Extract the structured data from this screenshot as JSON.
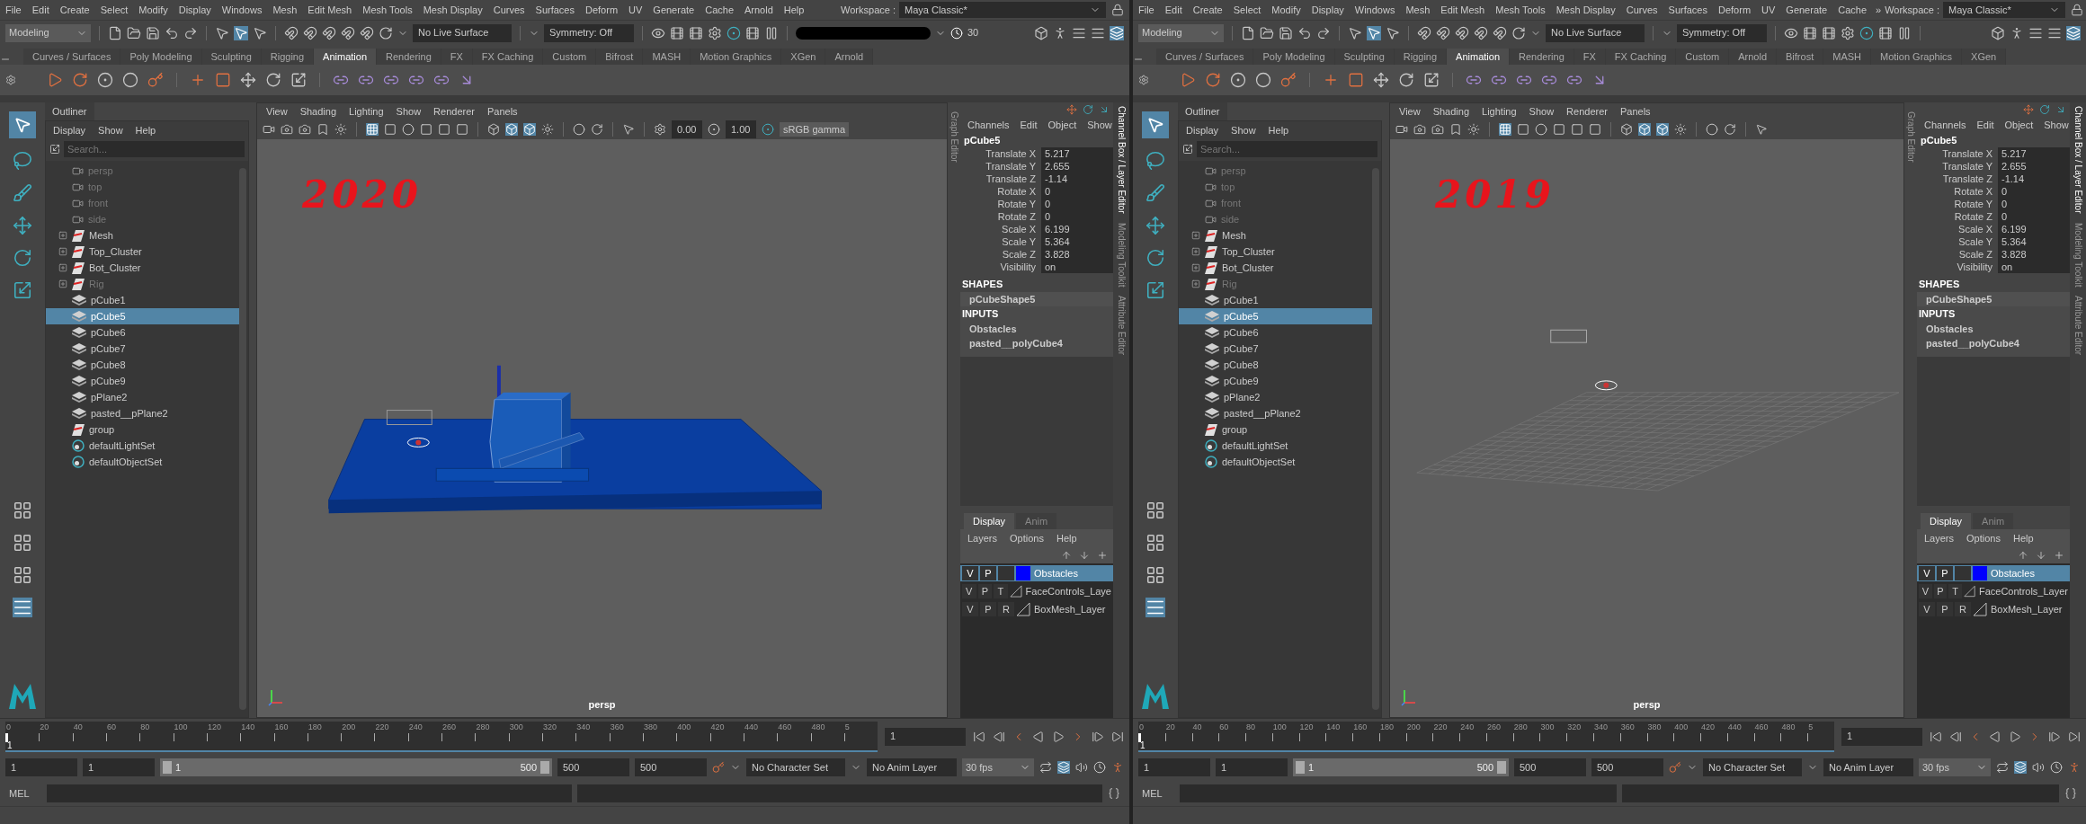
{
  "windows": [
    {
      "menus": [
        "File",
        "Edit",
        "Create",
        "Select",
        "Modify",
        "Display",
        "Windows",
        "Mesh",
        "Edit Mesh",
        "Mesh Tools",
        "Mesh Display",
        "Curves",
        "Surfaces",
        "Deform",
        "UV",
        "Generate",
        "Cache",
        "Arnold",
        "Help"
      ],
      "workspace_label": "Workspace :",
      "workspace": "Maya Classic*",
      "mode": "Modeling",
      "live_surface": "No Live Surface",
      "symmetry": "Symmetry: Off",
      "redacted": true,
      "timer": "30",
      "shelf_tabs": [
        {
          "label": "Curves / Surfaces",
          "selected": false
        },
        {
          "label": "Poly Modeling",
          "selected": false
        },
        {
          "label": "Sculpting",
          "selected": false
        },
        {
          "label": "Rigging",
          "selected": false
        },
        {
          "label": "Animation",
          "selected": true
        },
        {
          "label": "Rendering",
          "selected": false
        },
        {
          "label": "FX",
          "selected": false
        },
        {
          "label": "FX Caching",
          "selected": false
        },
        {
          "label": "Custom",
          "selected": false
        },
        {
          "label": "Bifrost",
          "selected": false
        },
        {
          "label": "MASH",
          "selected": false
        },
        {
          "label": "Motion Graphics",
          "selected": false
        },
        {
          "label": "XGen",
          "selected": false
        },
        {
          "label": "Arnold",
          "selected": false
        }
      ],
      "outliner": {
        "title": "Outliner",
        "menus": [
          "Display",
          "Show",
          "Help"
        ],
        "search_placeholder": "Search...",
        "items": [
          {
            "label": "persp",
            "kind": "camera",
            "dimmed": true,
            "expandable": false,
            "selected": false
          },
          {
            "label": "top",
            "kind": "camera",
            "dimmed": true,
            "expandable": false,
            "selected": false
          },
          {
            "label": "front",
            "kind": "camera",
            "dimmed": true,
            "expandable": false,
            "selected": false
          },
          {
            "label": "side",
            "kind": "camera",
            "dimmed": true,
            "expandable": false,
            "selected": false
          },
          {
            "label": "Mesh",
            "kind": "group",
            "dimmed": false,
            "expandable": true,
            "selected": false
          },
          {
            "label": "Top_Cluster",
            "kind": "group",
            "dimmed": false,
            "expandable": true,
            "selected": false
          },
          {
            "label": "Bot_Cluster",
            "kind": "group",
            "dimmed": false,
            "expandable": true,
            "selected": false
          },
          {
            "label": "Rig",
            "kind": "group",
            "dimmed": true,
            "expandable": true,
            "selected": false
          },
          {
            "label": "pCube1",
            "kind": "mesh",
            "dimmed": false,
            "expandable": false,
            "selected": false
          },
          {
            "label": "pCube5",
            "kind": "mesh",
            "dimmed": false,
            "expandable": false,
            "selected": true
          },
          {
            "label": "pCube6",
            "kind": "mesh",
            "dimmed": false,
            "expandable": false,
            "selected": false
          },
          {
            "label": "pCube7",
            "kind": "mesh",
            "dimmed": false,
            "expandable": false,
            "selected": false
          },
          {
            "label": "pCube8",
            "kind": "mesh",
            "dimmed": false,
            "expandable": false,
            "selected": false
          },
          {
            "label": "pCube9",
            "kind": "mesh",
            "dimmed": false,
            "expandable": false,
            "selected": false
          },
          {
            "label": "pPlane2",
            "kind": "mesh",
            "dimmed": false,
            "expandable": false,
            "selected": false
          },
          {
            "label": "pasted__pPlane2",
            "kind": "mesh",
            "dimmed": false,
            "expandable": false,
            "selected": false
          },
          {
            "label": "group",
            "kind": "group",
            "dimmed": false,
            "expandable": false,
            "selected": false
          },
          {
            "label": "defaultLightSet",
            "kind": "set",
            "dimmed": false,
            "expandable": false,
            "selected": false
          },
          {
            "label": "defaultObjectSet",
            "kind": "set",
            "dimmed": false,
            "expandable": false,
            "selected": false
          }
        ]
      },
      "viewport": {
        "menus": [
          "View",
          "Shading",
          "Lighting",
          "Show",
          "Renderer",
          "Panels"
        ],
        "exposure": "0.00",
        "gamma": "1.00",
        "color_space": "sRGB gamma",
        "annotation": "2020",
        "scene": {
          "kind": "blue-obstacles"
        },
        "camera": "persp"
      },
      "graph_editor_tab": "Graph Editor",
      "channel_box": {
        "menus": [
          "Channels",
          "Edit",
          "Object",
          "Show"
        ],
        "object": "pCube5",
        "attributes": [
          {
            "label": "Translate X",
            "value": "5.217"
          },
          {
            "label": "Translate Y",
            "value": "2.655"
          },
          {
            "label": "Translate Z",
            "value": "-1.14"
          },
          {
            "label": "Rotate X",
            "value": "0"
          },
          {
            "label": "Rotate Y",
            "value": "0"
          },
          {
            "label": "Rotate Z",
            "value": "0"
          },
          {
            "label": "Scale X",
            "value": "6.199"
          },
          {
            "label": "Scale Y",
            "value": "5.364"
          },
          {
            "label": "Scale Z",
            "value": "3.828"
          },
          {
            "label": "Visibility",
            "value": "on"
          }
        ],
        "shapes_header": "SHAPES",
        "shapes": [
          "pCubeShape5"
        ],
        "inputs_header": "INPUTS",
        "inputs": [
          "Obstacles",
          "pasted__polyCube4"
        ]
      },
      "layer_editor": {
        "tabs": [
          {
            "label": "Display",
            "selected": true
          },
          {
            "label": "Anim",
            "selected": false
          }
        ],
        "menus": [
          "Layers",
          "Options",
          "Help"
        ],
        "layers": [
          {
            "v": "V",
            "p": "P",
            "name": "Obstacles",
            "selected": true,
            "color": "#0000ff"
          },
          {
            "v": "V",
            "p": "P",
            "type": "T",
            "name": "FaceControls_Laye",
            "selected": false
          },
          {
            "v": "V",
            "p": "P",
            "type": "R",
            "name": "BoxMesh_Layer",
            "selected": false
          }
        ]
      },
      "side_tabs": [
        "Channel Box / Layer Editor",
        "Modeling Toolkit",
        "Attribute Editor"
      ],
      "timeline": {
        "ticks": [
          "0",
          "20",
          "40",
          "60",
          "80",
          "100",
          "120",
          "140",
          "160",
          "180",
          "200",
          "220",
          "240",
          "260",
          "280",
          "300",
          "320",
          "340",
          "360",
          "380",
          "400",
          "420",
          "440",
          "460",
          "480",
          "5"
        ],
        "current_frame": "1",
        "frame_field": "1",
        "level": 0
      },
      "range": {
        "start": "1",
        "playback_start": "1",
        "slider_start": "1",
        "slider_end": "500",
        "level": 1,
        "playback_end": "500",
        "end": "500",
        "character_set": "No Character Set",
        "anim_layer": "No Anim Layer",
        "fps": "30 fps"
      },
      "command": {
        "language": "MEL"
      }
    },
    {
      "menus": [
        "File",
        "Edit",
        "Create",
        "Select",
        "Modify",
        "Display",
        "Windows",
        "Mesh",
        "Edit Mesh",
        "Mesh Tools",
        "Mesh Display",
        "Curves",
        "Surfaces",
        "Deform",
        "UV",
        "Generate",
        "Cache"
      ],
      "overflow": "»",
      "workspace_label": "Workspace :",
      "workspace": "Maya Classic*",
      "mode": "Modeling",
      "live_surface": "No Live Surface",
      "symmetry": "Symmetry: Off",
      "shelf_tabs": [
        {
          "label": "Curves / Surfaces",
          "selected": false
        },
        {
          "label": "Poly Modeling",
          "selected": false
        },
        {
          "label": "Sculpting",
          "selected": false
        },
        {
          "label": "Rigging",
          "selected": false
        },
        {
          "label": "Animation",
          "selected": true
        },
        {
          "label": "Rendering",
          "selected": false
        },
        {
          "label": "FX",
          "selected": false
        },
        {
          "label": "FX Caching",
          "selected": false
        },
        {
          "label": "Custom",
          "selected": false
        },
        {
          "label": "Arnold",
          "selected": false
        },
        {
          "label": "Bifrost",
          "selected": false
        },
        {
          "label": "MASH",
          "selected": false
        },
        {
          "label": "Motion Graphics",
          "selected": false
        },
        {
          "label": "XGen",
          "selected": false
        }
      ],
      "outliner": {
        "title": "Outliner",
        "menus": [
          "Display",
          "Show",
          "Help"
        ],
        "search_placeholder": "Search...",
        "items": [
          {
            "label": "persp",
            "kind": "camera",
            "dimmed": true,
            "expandable": false,
            "selected": false
          },
          {
            "label": "top",
            "kind": "camera",
            "dimmed": true,
            "expandable": false,
            "selected": false
          },
          {
            "label": "front",
            "kind": "camera",
            "dimmed": true,
            "expandable": false,
            "selected": false
          },
          {
            "label": "side",
            "kind": "camera",
            "dimmed": true,
            "expandable": false,
            "selected": false
          },
          {
            "label": "Mesh",
            "kind": "group",
            "dimmed": false,
            "expandable": true,
            "selected": false
          },
          {
            "label": "Top_Cluster",
            "kind": "group",
            "dimmed": false,
            "expandable": true,
            "selected": false
          },
          {
            "label": "Bot_Cluster",
            "kind": "group",
            "dimmed": false,
            "expandable": true,
            "selected": false
          },
          {
            "label": "Rig",
            "kind": "group",
            "dimmed": true,
            "expandable": true,
            "selected": false
          },
          {
            "label": "pCube1",
            "kind": "mesh",
            "dimmed": false,
            "expandable": false,
            "selected": false
          },
          {
            "label": "pCube5",
            "kind": "mesh",
            "dimmed": false,
            "expandable": false,
            "selected": true
          },
          {
            "label": "pCube6",
            "kind": "mesh",
            "dimmed": false,
            "expandable": false,
            "selected": false
          },
          {
            "label": "pCube7",
            "kind": "mesh",
            "dimmed": false,
            "expandable": false,
            "selected": false
          },
          {
            "label": "pCube8",
            "kind": "mesh",
            "dimmed": false,
            "expandable": false,
            "selected": false
          },
          {
            "label": "pCube9",
            "kind": "mesh",
            "dimmed": false,
            "expandable": false,
            "selected": false
          },
          {
            "label": "pPlane2",
            "kind": "mesh",
            "dimmed": false,
            "expandable": false,
            "selected": false
          },
          {
            "label": "pasted__pPlane2",
            "kind": "mesh",
            "dimmed": false,
            "expandable": false,
            "selected": false
          },
          {
            "label": "group",
            "kind": "group",
            "dimmed": false,
            "expandable": false,
            "selected": false
          },
          {
            "label": "defaultLightSet",
            "kind": "set",
            "dimmed": false,
            "expandable": false,
            "selected": false
          },
          {
            "label": "defaultObjectSet",
            "kind": "set",
            "dimmed": false,
            "expandable": false,
            "selected": false
          }
        ]
      },
      "viewport": {
        "menus": [
          "View",
          "Shading",
          "Lighting",
          "Show",
          "Renderer",
          "Panels"
        ],
        "annotation": "2019",
        "scene": {
          "kind": "grid"
        },
        "camera": "persp"
      },
      "graph_editor_tab": "Graph Editor",
      "channel_box": {
        "menus": [
          "Channels",
          "Edit",
          "Object",
          "Show"
        ],
        "object": "pCube5",
        "attributes": [
          {
            "label": "Translate X",
            "value": "5.217"
          },
          {
            "label": "Translate Y",
            "value": "2.655"
          },
          {
            "label": "Translate Z",
            "value": "-1.14"
          },
          {
            "label": "Rotate X",
            "value": "0"
          },
          {
            "label": "Rotate Y",
            "value": "0"
          },
          {
            "label": "Rotate Z",
            "value": "0"
          },
          {
            "label": "Scale X",
            "value": "6.199"
          },
          {
            "label": "Scale Y",
            "value": "5.364"
          },
          {
            "label": "Scale Z",
            "value": "3.828"
          },
          {
            "label": "Visibility",
            "value": "on"
          }
        ],
        "shapes_header": "SHAPES",
        "shapes": [
          "pCubeShape5"
        ],
        "inputs_header": "INPUTS",
        "inputs": [
          "Obstacles",
          "pasted__polyCube4"
        ]
      },
      "layer_editor": {
        "tabs": [
          {
            "label": "Display",
            "selected": true
          },
          {
            "label": "Anim",
            "selected": false
          }
        ],
        "menus": [
          "Layers",
          "Options",
          "Help"
        ],
        "layers": [
          {
            "v": "V",
            "p": "P",
            "name": "Obstacles",
            "selected": true,
            "color": "#0000ff"
          },
          {
            "v": "V",
            "p": "P",
            "type": "T",
            "name": "FaceControls_Layer",
            "selected": false
          },
          {
            "v": "V",
            "p": "P",
            "type": "R",
            "name": "BoxMesh_Layer",
            "selected": false
          }
        ]
      },
      "side_tabs": [
        "Channel Box / Layer Editor",
        "Modeling Toolkit",
        "Attribute Editor"
      ],
      "timeline": {
        "ticks": [
          "0",
          "20",
          "40",
          "60",
          "80",
          "100",
          "120",
          "140",
          "160",
          "180",
          "200",
          "220",
          "240",
          "260",
          "280",
          "300",
          "320",
          "340",
          "360",
          "380",
          "400",
          "420",
          "440",
          "460",
          "480",
          "5"
        ],
        "current_frame": "1",
        "frame_field": "1",
        "level": 0
      },
      "range": {
        "start": "1",
        "playback_start": "1",
        "slider_start": "1",
        "slider_end": "500",
        "level": 1,
        "playback_end": "500",
        "end": "500",
        "character_set": "No Character Set",
        "anim_layer": "No Anim Layer",
        "fps": "30 fps"
      },
      "command": {
        "language": "MEL"
      }
    }
  ]
}
